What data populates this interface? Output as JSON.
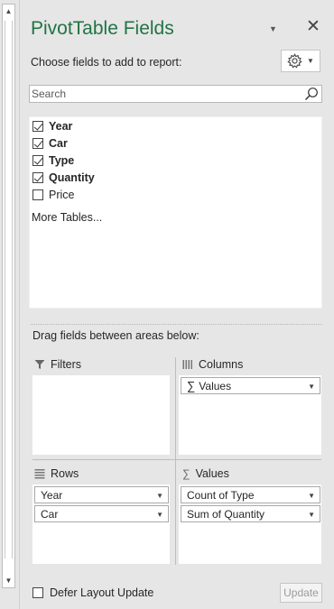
{
  "panel": {
    "title": "PivotTable Fields",
    "choose_label": "Choose fields to add to report:",
    "search_placeholder": "Search",
    "accent_color": "#217346"
  },
  "fields": [
    {
      "label": "Year",
      "checked": true
    },
    {
      "label": "Car",
      "checked": true
    },
    {
      "label": "Type",
      "checked": true
    },
    {
      "label": "Quantity",
      "checked": true
    },
    {
      "label": "Price",
      "checked": false
    }
  ],
  "more_tables": "More Tables...",
  "drag_label": "Drag fields between areas below:",
  "areas": {
    "filters": {
      "label": "Filters",
      "icon": "filter-icon",
      "items": []
    },
    "columns": {
      "label": "Columns",
      "icon": "columns-icon",
      "items": [
        "Values"
      ]
    },
    "rows": {
      "label": "Rows",
      "icon": "rows-icon",
      "items": [
        "Year",
        "Car"
      ]
    },
    "values": {
      "label": "Values",
      "icon": "sigma-icon",
      "items": [
        "Count of Type",
        "Sum of Quantity"
      ]
    }
  },
  "footer": {
    "defer_label": "Defer Layout Update",
    "defer_checked": false,
    "update_label": "Update"
  }
}
